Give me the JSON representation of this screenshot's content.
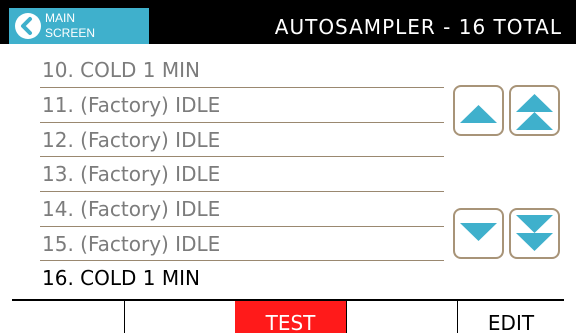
{
  "header": {
    "main_screen_label": "MAIN\nSCREEN",
    "title": "AUTOSAMPLER - 16 TOTAL"
  },
  "list": {
    "items": [
      {
        "label": "10. COLD 1 MIN"
      },
      {
        "label": "11. (Factory) IDLE"
      },
      {
        "label": "12. (Factory) IDLE"
      },
      {
        "label": "13. (Factory) IDLE"
      },
      {
        "label": "14. (Factory) IDLE"
      },
      {
        "label": "15. (Factory) IDLE"
      },
      {
        "label": "16. COLD 1 MIN"
      }
    ],
    "selected_label": "16. COLD 1 MIN"
  },
  "scroll_buttons": {
    "up": "chevron-up-icon",
    "page_up": "double-chevron-up-icon",
    "down": "chevron-down-icon",
    "page_down": "double-chevron-down-icon"
  },
  "footer": {
    "buttons": [
      {
        "label": ""
      },
      {
        "label": ""
      },
      {
        "label": "TEST"
      },
      {
        "label": ""
      },
      {
        "label": "EDIT"
      }
    ]
  },
  "colors": {
    "accent": "#3fb0cc",
    "header_bg": "#000000",
    "test_button": "#ff1a1a",
    "border": "#a89478",
    "inactive_text": "#7c7c7c"
  }
}
